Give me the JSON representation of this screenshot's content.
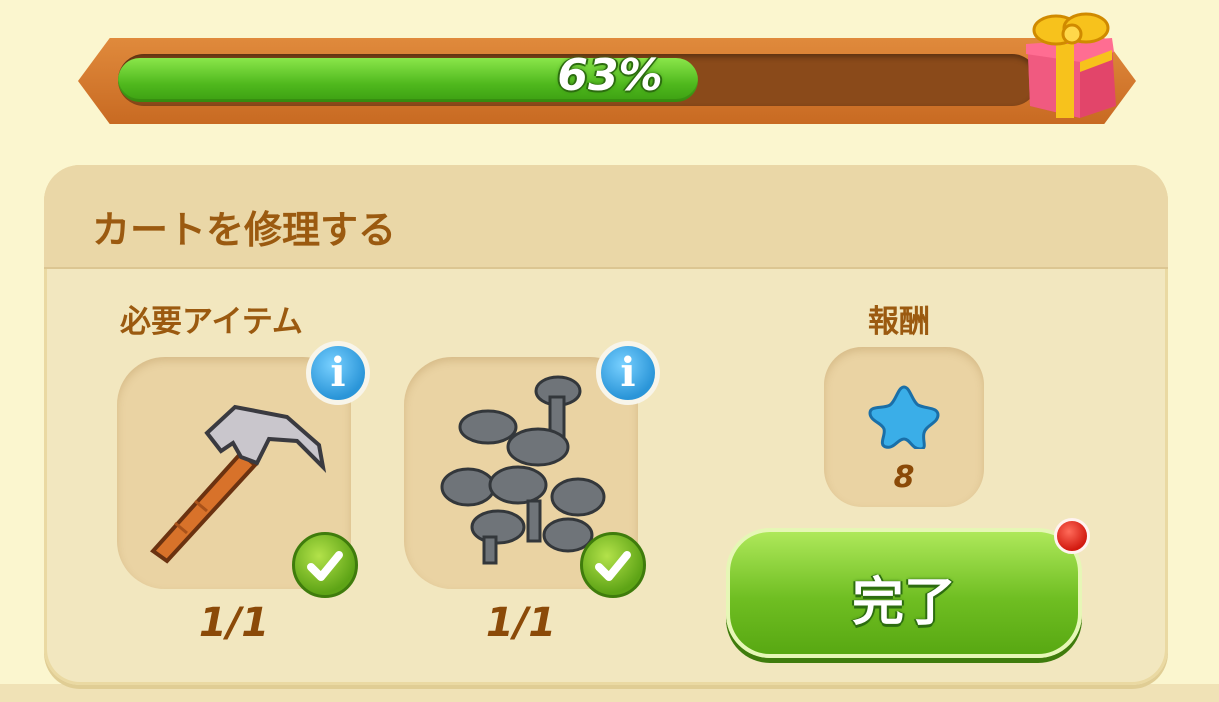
{
  "progress": {
    "percent_label": "63%",
    "fraction": 0.63
  },
  "panel": {
    "title": "カートを修理する",
    "required_label": "必要アイテム",
    "reward_label": "報酬"
  },
  "items": [
    {
      "name": "hammer",
      "count": "1/1",
      "info_symbol": "i"
    },
    {
      "name": "screws",
      "count": "1/1",
      "info_symbol": "i"
    }
  ],
  "reward": {
    "icon": "blue-star-icon",
    "count": "8"
  },
  "complete_button": {
    "label": "完了"
  }
}
